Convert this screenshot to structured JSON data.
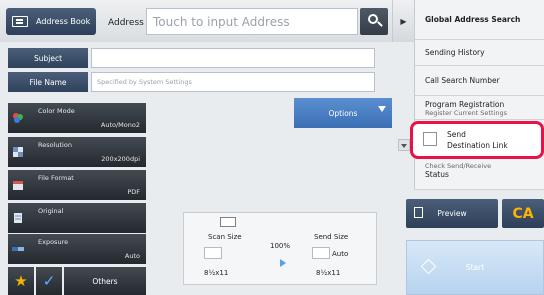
{
  "header": {
    "address_book_label": "Address Book",
    "address_label": "Address",
    "address_placeholder": "Touch to input Address"
  },
  "fields": {
    "subject_label": "Subject",
    "subject_value": "",
    "file_name_label": "File Name",
    "file_name_placeholder": "Specified by System Settings",
    "options_label": "Options"
  },
  "settings": [
    {
      "title": "Color Mode",
      "value": "Auto/Mono2",
      "icon": "color-mode-icon"
    },
    {
      "title": "Resolution",
      "value": "200x200dpi",
      "icon": "resolution-icon"
    },
    {
      "title": "File Format",
      "value": "PDF",
      "icon": "file-format-icon"
    },
    {
      "title": "Original",
      "value": "",
      "icon": "original-icon"
    },
    {
      "title": "Exposure",
      "value": "Auto",
      "icon": "exposure-icon"
    }
  ],
  "bottom": {
    "others_label": "Others"
  },
  "preview_panel": {
    "scan_size_label": "Scan Size",
    "scan_size_value": "8½x11",
    "ratio": "100%",
    "send_size_label": "Send Size",
    "send_size_auto": "Auto",
    "send_size_value": "8½x11"
  },
  "menu": {
    "items": [
      "Global Address Search",
      "Sending History",
      "Call Search Number",
      "Program Registration",
      "Register Current Settings",
      "Send Destination Link",
      "Check Send/Receive Status"
    ],
    "send_link_line1": "Send",
    "send_link_line2": "Destination Link",
    "check_status_line1": "Check Send/Receive",
    "check_status_line2": "Status"
  },
  "actions": {
    "preview_label": "Preview",
    "ca_label": "CA",
    "start_label": "Start"
  },
  "colors": {
    "highlight": "#e8114a",
    "tile_dark": "#2d333a",
    "button_navy": "#3a4d68",
    "options_blue": "#4a80c4",
    "ca_text": "#ffb400"
  }
}
